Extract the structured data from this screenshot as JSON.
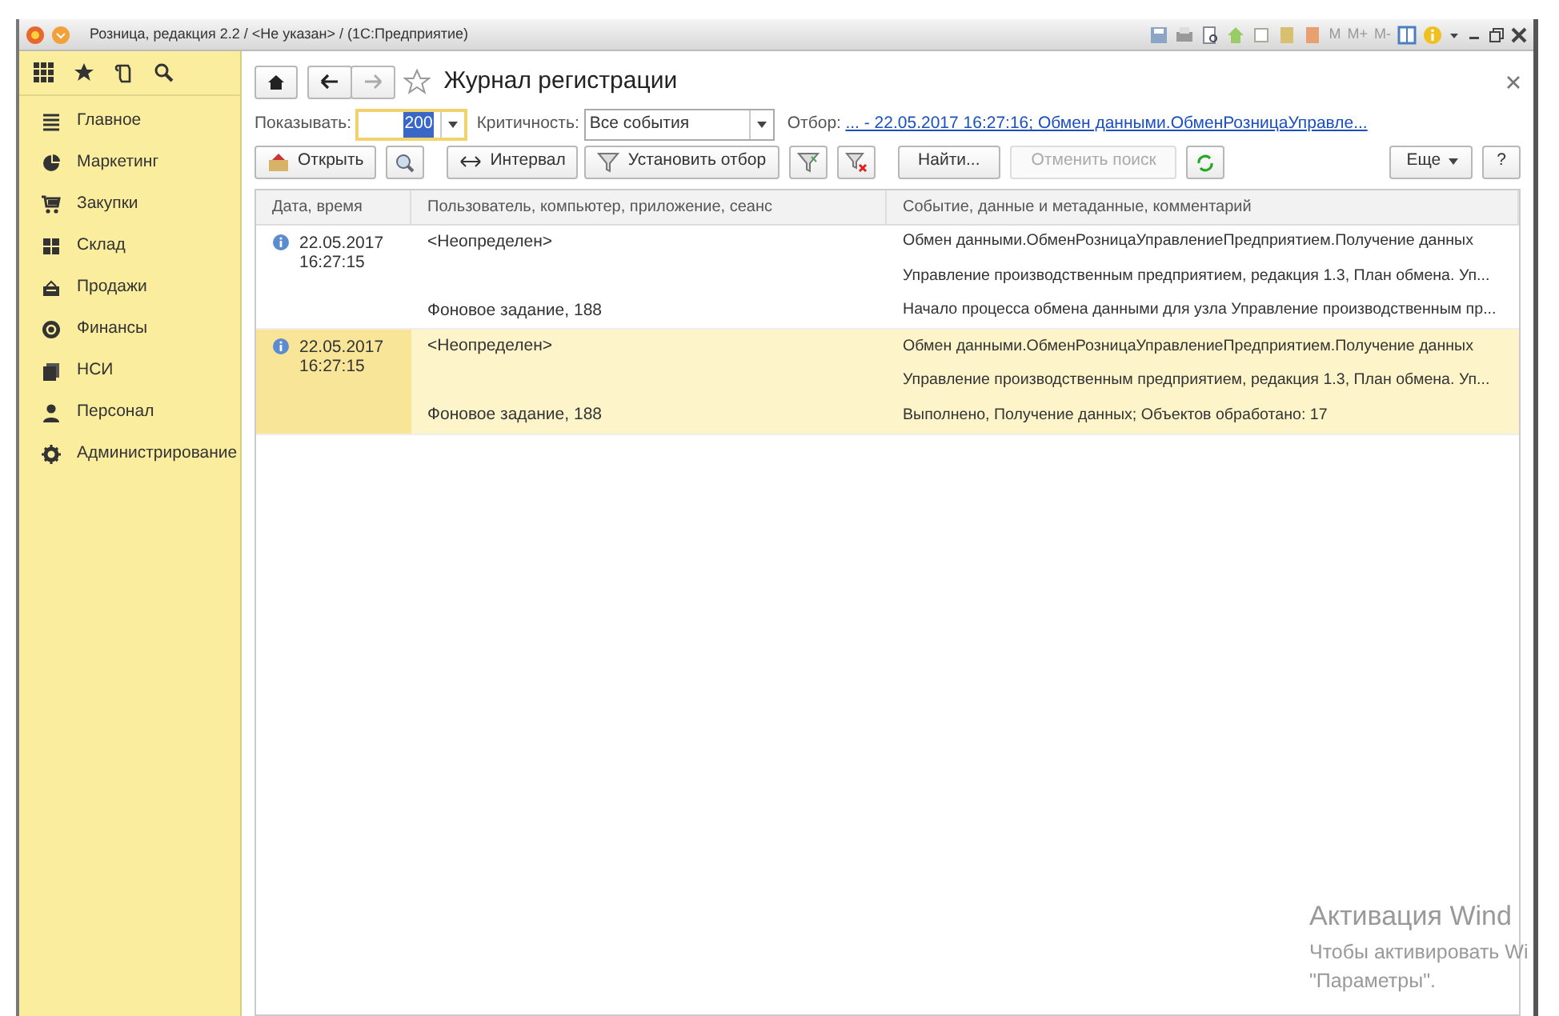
{
  "window": {
    "title": "Розница, редакция 2.2 / <Не указан> / (1С:Предприятие)",
    "memory_keys": [
      "M",
      "M+",
      "M-"
    ]
  },
  "sidebar": {
    "items": [
      {
        "label": "Главное"
      },
      {
        "label": "Маркетинг"
      },
      {
        "label": "Закупки"
      },
      {
        "label": "Склад"
      },
      {
        "label": "Продажи"
      },
      {
        "label": "Финансы"
      },
      {
        "label": "НСИ"
      },
      {
        "label": "Персонал"
      },
      {
        "label": "Администрирование"
      }
    ]
  },
  "form": {
    "title": "Журнал регистрации",
    "favorite": false,
    "filters": {
      "show_label": "Показывать:",
      "show_value": "200",
      "criticality_label": "Критичность:",
      "criticality_value": "Все события",
      "filter_label": "Отбор:",
      "filter_link": "... - 22.05.2017 16:27:16; Обмен данными.ОбменРозницаУправле..."
    },
    "toolbar": [
      {
        "kind": "icon-text",
        "label": "Открыть",
        "disabled": false
      },
      {
        "kind": "icon",
        "disabled": false
      },
      {
        "kind": "icon-text",
        "label": "Интервал",
        "disabled": false
      },
      {
        "kind": "icon-text",
        "label": "Установить отбор",
        "disabled": false
      },
      {
        "kind": "icon",
        "disabled": false
      },
      {
        "kind": "icon",
        "disabled": false
      },
      {
        "kind": "text",
        "label": "Найти...",
        "disabled": false
      },
      {
        "kind": "text",
        "label": "Отменить поиск",
        "disabled": true
      },
      {
        "kind": "icon",
        "disabled": false
      },
      {
        "kind": "menu",
        "label": "Еще",
        "disabled": false
      },
      {
        "kind": "text",
        "label": "?",
        "disabled": false
      }
    ],
    "table": {
      "columns": [
        "Дата, время",
        "Пользователь, компьютер, приложение, сеанс",
        "Событие, данные и метаданные, комментарий"
      ],
      "rows": [
        {
          "selected": false,
          "date": "22.05.2017",
          "time": "16:27:15",
          "lines": [
            {
              "user": "<Неопределен>",
              "event": "Обмен данными.ОбменРозницаУправлениеПредприятием.Получение данных"
            },
            {
              "event": "Управление производственным предприятием, редакция 1.3, План обмена. Уп..."
            },
            {
              "user": "Фоновое задание, 188",
              "event": "Начало процесса обмена данными для узла Управление производственным пр..."
            }
          ]
        },
        {
          "selected": true,
          "date": "22.05.2017",
          "time": "16:27:15",
          "lines": [
            {
              "user": "<Неопределен>",
              "event": "Обмен данными.ОбменРозницаУправлениеПредприятием.Получение данных"
            },
            {
              "event": "Управление производственным предприятием, редакция 1.3, План обмена. Уп..."
            },
            {
              "user": "Фоновое задание, 188",
              "event": "Выполнено, Получение данных; Объектов обработано: 17"
            }
          ]
        }
      ]
    }
  },
  "os_notice": {
    "title": "Активация Wind",
    "lines": [
      "Чтобы активировать Wi",
      "\"Параметры\"."
    ]
  }
}
